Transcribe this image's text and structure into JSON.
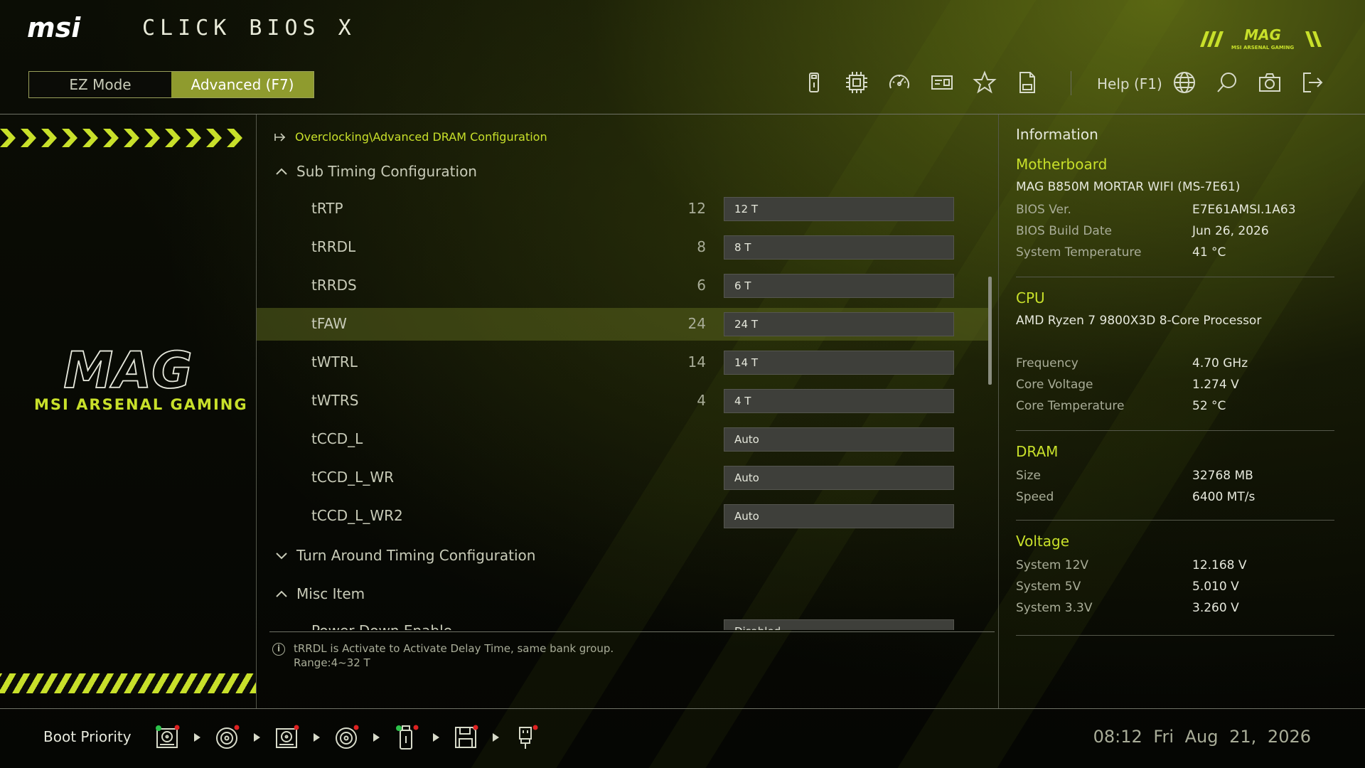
{
  "header": {
    "brand": "msi",
    "app_title": "CLICK BIOS X",
    "mag_logo_text": "MAG",
    "mag_logo_sub": "MSI ARSENAL GAMING",
    "modes": {
      "ez": "EZ Mode",
      "advanced": "Advanced (F7)",
      "active": "advanced"
    },
    "toolbar_icons": [
      "usb-drive-icon",
      "cpu-chip-icon",
      "gauge-icon",
      "memory-card-icon",
      "star-icon",
      "log-file-icon"
    ],
    "help_label": "Help (F1)",
    "right_icons": [
      "globe-icon",
      "search-icon",
      "camera-icon",
      "exit-icon"
    ]
  },
  "left_panel": {
    "logo_text": "MAG",
    "logo_sub": "MSI ARSENAL GAMING"
  },
  "main": {
    "breadcrumb": "Overclocking\\Advanced DRAM Configuration",
    "sections": [
      {
        "label": "Sub Timing Configuration",
        "state": "expanded"
      },
      {
        "label": "Turn Around Timing Configuration",
        "state": "collapsed"
      },
      {
        "label": "Misc Item",
        "state": "expanded"
      }
    ],
    "rows": [
      {
        "label": "tRTP",
        "current": "12",
        "value": "12 T"
      },
      {
        "label": "tRRDL",
        "current": "8",
        "value": "8 T"
      },
      {
        "label": "tRRDS",
        "current": "6",
        "value": "6 T"
      },
      {
        "label": "tFAW",
        "current": "24",
        "value": "24 T",
        "highlighted": true
      },
      {
        "label": "tWTRL",
        "current": "14",
        "value": "14 T"
      },
      {
        "label": "tWTRS",
        "current": "4",
        "value": "4 T"
      },
      {
        "label": "tCCD_L",
        "current": "",
        "value": "Auto"
      },
      {
        "label": "tCCD_L_WR",
        "current": "",
        "value": "Auto"
      },
      {
        "label": "tCCD_L_WR2",
        "current": "",
        "value": "Auto"
      }
    ],
    "misc_rows": [
      {
        "label": "Power Down Enable",
        "value": "Disabled",
        "dropdown": true
      }
    ],
    "help_text_line1": "tRRDL is Activate to Activate Delay Time, same bank group.",
    "help_text_line2": "Range:4~32 T"
  },
  "info": {
    "title": "Information",
    "motherboard": {
      "heading": "Motherboard",
      "model": "MAG B850M MORTAR WIFI (MS-7E61)",
      "bios_ver_label": "BIOS Ver.",
      "bios_ver": "E7E61AMSI.1A63",
      "bios_date_label": "BIOS Build Date",
      "bios_date": "Jun 26, 2026",
      "sys_temp_label": "System Temperature",
      "sys_temp": "41 °C"
    },
    "cpu": {
      "heading": "CPU",
      "model": "AMD Ryzen 7 9800X3D 8-Core Processor",
      "freq_label": "Frequency",
      "freq": "4.70 GHz",
      "volt_label": "Core Voltage",
      "volt": "1.274 V",
      "temp_label": "Core Temperature",
      "temp": "52 °C"
    },
    "dram": {
      "heading": "DRAM",
      "size_label": "Size",
      "size": "32768 MB",
      "speed_label": "Speed",
      "speed": "6400 MT/s"
    },
    "voltage": {
      "heading": "Voltage",
      "v12_label": "System 12V",
      "v12": "12.168 V",
      "v5_label": "System 5V",
      "v5": "5.010 V",
      "v33_label": "System 3.3V",
      "v33": "3.260 V"
    }
  },
  "footer": {
    "boot_label": "Boot Priority",
    "boot_devices": [
      "hdd-icon",
      "optical-disc-icon",
      "hdd-icon",
      "optical-disc-icon",
      "usb-key-icon",
      "floppy-icon",
      "usb-plug-icon"
    ],
    "time": "08:12",
    "date": "Fri Aug 21, 2026"
  },
  "colors": {
    "accent": "#c8e02a",
    "active_mode": "#8f9b2e",
    "highlight_row": "#5a641e",
    "field_bg": "#3e3f3a"
  }
}
